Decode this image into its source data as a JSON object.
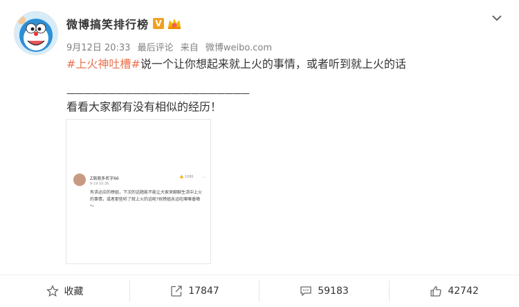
{
  "post": {
    "author": "微博搞笑排行榜",
    "vip_badge": "V",
    "date": "9月12日 20:33",
    "edit_status": "最后评论",
    "source_prefix": "来自",
    "source": "微博weibo.com",
    "topic": "#上火神吐槽#",
    "text_after_topic": "说一个让你想起来就上火的事情，或者听到就上火的话",
    "separator": "——————————————————————",
    "text_line2": "看看大家都有没有相似的经历！"
  },
  "embedded_comment": {
    "user": "Z周周多名字66",
    "time": "9-19 10:36",
    "likes": "1086",
    "more": "⋯",
    "body": "有求必应的榜姐，下次的话题能不能让大家来聊聊生活中上火的事情，或者那些听了就上火的话呢?祝榜姐永远吃嘛嘛香嗷～"
  },
  "actions": {
    "favorite_label": "收藏",
    "repost_count": "17847",
    "comment_count": "59183",
    "like_count": "42742"
  },
  "colors": {
    "topic": "#eb7350",
    "vip": "#f0a020",
    "meta": "#808080"
  },
  "icons": [
    "chevron-down-icon",
    "star-icon",
    "share-icon",
    "comment-icon",
    "thumbs-up-icon",
    "crown-icon"
  ]
}
